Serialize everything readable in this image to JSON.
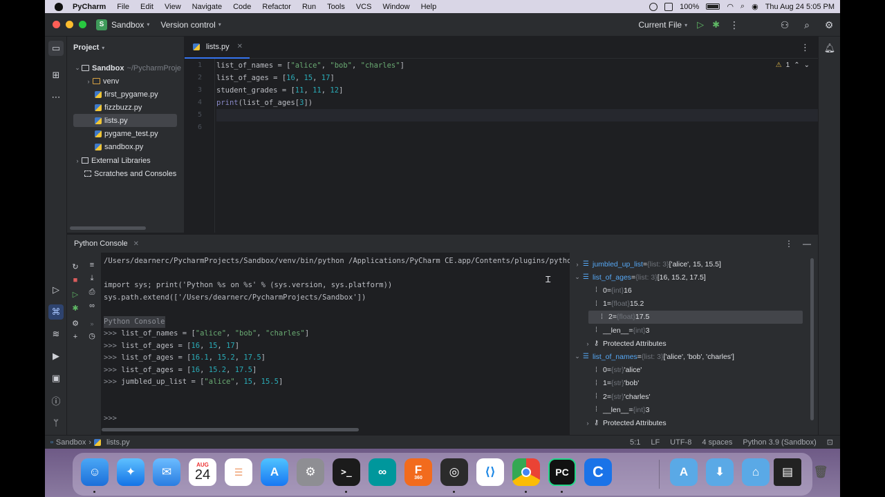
{
  "menubar": {
    "app": "PyCharm",
    "items": [
      "File",
      "Edit",
      "View",
      "Navigate",
      "Code",
      "Refactor",
      "Run",
      "Tools",
      "VCS",
      "Window",
      "Help"
    ],
    "battery": "100%",
    "clock": "Thu Aug 24  5:05 PM"
  },
  "titlebar": {
    "project_badge": "S",
    "project_name": "Sandbox",
    "vcs": "Version control",
    "run_config": "Current File"
  },
  "project_panel": {
    "title": "Project",
    "root": {
      "name": "Sandbox",
      "path": "~/PycharmProje"
    },
    "items": [
      "venv",
      "first_pygame.py",
      "fizzbuzz.py",
      "lists.py",
      "pygame_test.py",
      "sandbox.py"
    ],
    "external": "External Libraries",
    "scratches": "Scratches and Consoles"
  },
  "editor": {
    "tab": "lists.py",
    "warnings": "1",
    "line_numbers": [
      "1",
      "2",
      "3",
      "4",
      "5",
      "6"
    ],
    "lines": [
      [
        {
          "t": "list_of_names = [",
          "c": ""
        },
        {
          "t": "\"alice\"",
          "c": "str"
        },
        {
          "t": ", ",
          "c": ""
        },
        {
          "t": "\"bob\"",
          "c": "str"
        },
        {
          "t": ", ",
          "c": ""
        },
        {
          "t": "\"charles\"",
          "c": "str"
        },
        {
          "t": "]",
          "c": ""
        }
      ],
      [
        {
          "t": "list_of_ages = [",
          "c": ""
        },
        {
          "t": "16",
          "c": "num"
        },
        {
          "t": ", ",
          "c": ""
        },
        {
          "t": "15",
          "c": "num"
        },
        {
          "t": ", ",
          "c": ""
        },
        {
          "t": "17",
          "c": "num"
        },
        {
          "t": "]",
          "c": ""
        }
      ],
      [
        {
          "t": "student_grades = [",
          "c": ""
        },
        {
          "t": "11",
          "c": "num"
        },
        {
          "t": ", ",
          "c": ""
        },
        {
          "t": "11",
          "c": "num"
        },
        {
          "t": ", ",
          "c": ""
        },
        {
          "t": "12",
          "c": "num"
        },
        {
          "t": "]",
          "c": ""
        }
      ],
      [
        {
          "t": "print",
          "c": "bi"
        },
        {
          "t": "(list_of_ages[",
          "c": ""
        },
        {
          "t": "3",
          "c": "num"
        },
        {
          "t": "])",
          "c": ""
        }
      ],
      [],
      []
    ]
  },
  "console": {
    "tab": "Python Console",
    "lines": [
      [
        {
          "t": "/Users/dearnerc/PycharmProjects/Sandbox/venv/bin/python /Applications/PyCharm CE.app/Contents/plugins/python",
          "c": ""
        }
      ],
      [],
      [
        {
          "t": "import sys; print('Python %s on %s' % (sys.version, sys.platform))",
          "c": ""
        }
      ],
      [
        {
          "t": "sys.path.extend(['/Users/dearnerc/PycharmProjects/Sandbox'])",
          "c": ""
        }
      ],
      [],
      [
        {
          "t": "Python Console",
          "c": "hl"
        }
      ],
      [
        {
          "t": ">>> ",
          "c": "prompt"
        },
        {
          "t": "list_of_names = [",
          "c": ""
        },
        {
          "t": "\"alice\"",
          "c": "str"
        },
        {
          "t": ", ",
          "c": ""
        },
        {
          "t": "\"bob\"",
          "c": "str"
        },
        {
          "t": ", ",
          "c": ""
        },
        {
          "t": "\"charles\"",
          "c": "str"
        },
        {
          "t": "]",
          "c": ""
        }
      ],
      [
        {
          "t": ">>> ",
          "c": "prompt"
        },
        {
          "t": "list_of_ages = [",
          "c": ""
        },
        {
          "t": "16",
          "c": "num"
        },
        {
          "t": ", ",
          "c": ""
        },
        {
          "t": "15",
          "c": "num"
        },
        {
          "t": ", ",
          "c": ""
        },
        {
          "t": "17",
          "c": "num"
        },
        {
          "t": "]",
          "c": ""
        }
      ],
      [
        {
          "t": ">>> ",
          "c": "prompt"
        },
        {
          "t": "list_of_ages = [",
          "c": ""
        },
        {
          "t": "16.1",
          "c": "num"
        },
        {
          "t": ", ",
          "c": ""
        },
        {
          "t": "15.2",
          "c": "num"
        },
        {
          "t": ", ",
          "c": ""
        },
        {
          "t": "17.5",
          "c": "num"
        },
        {
          "t": "]",
          "c": ""
        }
      ],
      [
        {
          "t": ">>> ",
          "c": "prompt"
        },
        {
          "t": "list_of_ages = [",
          "c": ""
        },
        {
          "t": "16",
          "c": "num"
        },
        {
          "t": ", ",
          "c": ""
        },
        {
          "t": "15.2",
          "c": "num"
        },
        {
          "t": ", ",
          "c": ""
        },
        {
          "t": "17.5",
          "c": "num"
        },
        {
          "t": "]",
          "c": ""
        }
      ],
      [
        {
          "t": ">>> ",
          "c": "prompt"
        },
        {
          "t": "jumbled_up_list = [",
          "c": ""
        },
        {
          "t": "\"alice\"",
          "c": "str"
        },
        {
          "t": ", ",
          "c": ""
        },
        {
          "t": "15",
          "c": "num"
        },
        {
          "t": ", ",
          "c": ""
        },
        {
          "t": "15.5",
          "c": "num"
        },
        {
          "t": "]",
          "c": ""
        }
      ],
      [],
      [],
      [
        {
          "t": ">>>",
          "c": "prompt"
        }
      ]
    ]
  },
  "variables": [
    {
      "chev": "›",
      "icon": "list",
      "name": "jumbled_up_list",
      "type": "{list: 3}",
      "value": "['alice', 15, 15.5]",
      "indent": 0
    },
    {
      "chev": "⌄",
      "icon": "list",
      "name": "list_of_ages",
      "type": "{list: 3}",
      "value": "[16, 15.2, 17.5]",
      "indent": 0
    },
    {
      "chev": "",
      "icon": "field",
      "name": "0",
      "type": "{int}",
      "value": "16",
      "indent": 1
    },
    {
      "chev": "",
      "icon": "field",
      "name": "1",
      "type": "{float}",
      "value": "15.2",
      "indent": 1
    },
    {
      "chev": "",
      "icon": "field",
      "name": "2",
      "type": "{float}",
      "value": "17.5",
      "indent": 1,
      "selected": true
    },
    {
      "chev": "",
      "icon": "field",
      "name": "__len__",
      "type": "{int}",
      "value": "3",
      "indent": 1
    },
    {
      "chev": "›",
      "icon": "key",
      "name": "Protected Attributes",
      "type": "",
      "value": "",
      "indent": 1,
      "plain": true
    },
    {
      "chev": "⌄",
      "icon": "list",
      "name": "list_of_names",
      "type": "{list: 3}",
      "value": "['alice', 'bob', 'charles']",
      "indent": 0
    },
    {
      "chev": "",
      "icon": "field",
      "name": "0",
      "type": "{str}",
      "value": "'alice'",
      "indent": 1
    },
    {
      "chev": "",
      "icon": "field",
      "name": "1",
      "type": "{str}",
      "value": "'bob'",
      "indent": 1
    },
    {
      "chev": "",
      "icon": "field",
      "name": "2",
      "type": "{str}",
      "value": "'charles'",
      "indent": 1
    },
    {
      "chev": "",
      "icon": "field",
      "name": "__len__",
      "type": "{int}",
      "value": "3",
      "indent": 1
    },
    {
      "chev": "›",
      "icon": "key",
      "name": "Protected Attributes",
      "type": "",
      "value": "",
      "indent": 1,
      "plain": true
    }
  ],
  "statusbar": {
    "project": "Sandbox",
    "file": "lists.py",
    "position": "5:1",
    "line_sep": "LF",
    "encoding": "UTF-8",
    "indent": "4 spaces",
    "interpreter": "Python 3.9 (Sandbox)"
  },
  "dock": {
    "calendar_month": "AUG",
    "calendar_day": "24",
    "terminal_glyph": ">_",
    "pycharm_glyph": "PC",
    "fusion_glyph": "F",
    "fusion_sub": "360"
  }
}
